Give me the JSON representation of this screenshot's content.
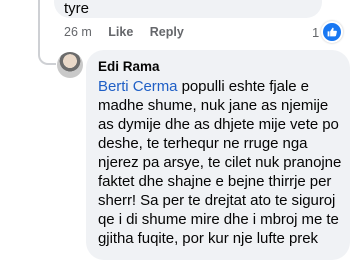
{
  "previous_comment": {
    "text_tail": "tyre",
    "time": "26 m",
    "like_label": "Like",
    "reply_label": "Reply",
    "reaction_count": "1",
    "reaction_icon": "like-thumb-icon",
    "reaction_color": "#1877f2"
  },
  "reply": {
    "author": "Edi Rama",
    "mention": "Berti Cerma",
    "text": " populli eshte fjale e madhe shume, nuk jane as njemije as dymije dhe as dhjete mije vete po deshe, te terhequr ne rruge nga njerez pa arsye, te cilet nuk pranojne faktet dhe shajne e bejne thirrje per sherr! Sa per te drejtat ato te siguroj qe i di shume mire dhe i mbroj me te gjitha fuqite, por kur nje lufte prek",
    "mention_color": "#1f5fc6"
  }
}
